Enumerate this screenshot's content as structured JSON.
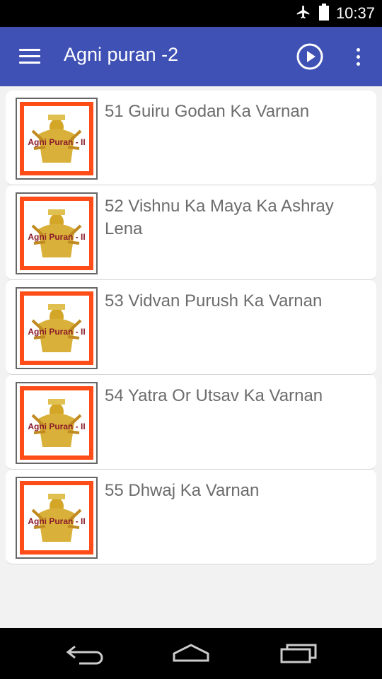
{
  "status_bar": {
    "time": "10:37",
    "icons": [
      "airplane-mode-icon",
      "battery-icon"
    ]
  },
  "app_bar": {
    "title": "Agni puran -2",
    "actions": [
      "menu-icon",
      "play-icon",
      "more-vert-icon"
    ]
  },
  "list": {
    "items": [
      {
        "title": "51 Guiru Godan Ka Varnan",
        "thumb_label": "Agni Puran - II"
      },
      {
        "title": "52 Vishnu Ka Maya Ka Ashray Lena",
        "thumb_label": "Agni Puran - II"
      },
      {
        "title": "53 Vidvan Purush Ka Varnan",
        "thumb_label": "Agni Puran - II"
      },
      {
        "title": "54 Yatra Or Utsav Ka Varnan",
        "thumb_label": "Agni Puran - II"
      },
      {
        "title": "55 Dhwaj Ka Varnan",
        "thumb_label": "Agni Puran - II"
      }
    ]
  },
  "nav_bar": {
    "buttons": [
      "back-icon",
      "home-icon",
      "recents-icon"
    ]
  },
  "colors": {
    "app_bar": "#3f51b5",
    "thumb_border": "#ff4d1a",
    "title_text": "#6c6c6c"
  }
}
